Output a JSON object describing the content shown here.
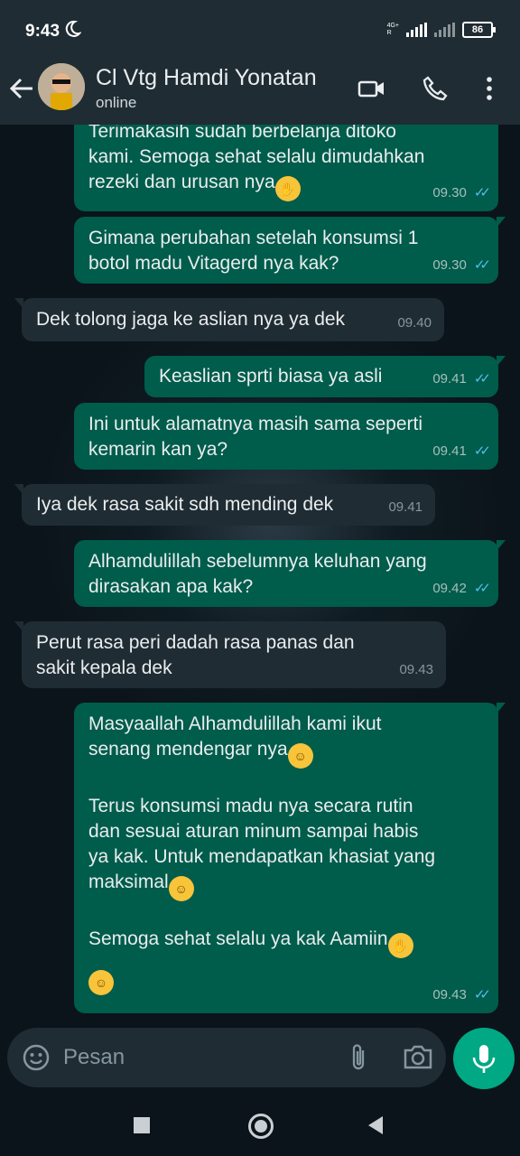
{
  "status_bar": {
    "time": "9:43",
    "network": "4G+",
    "network_sub": "R",
    "battery": "86"
  },
  "header": {
    "name": "Cl Vtg Hamdi Yonatan",
    "status": "online"
  },
  "messages": [
    {
      "dir": "out",
      "text": "Terimakasih sudah berbelanja ditoko\nkami. Semoga sehat selalu dimudahkan\nrezeki dan urusan nya",
      "emoji": "🤲",
      "time": "09.30",
      "read": true
    },
    {
      "dir": "out",
      "text": "Gimana perubahan setelah konsumsi 1\nbotol madu Vitagerd nya kak?",
      "time": "09.30",
      "read": true
    },
    {
      "dir": "in",
      "text": "Dek tolong jaga ke aslian nya ya dek",
      "time": "09.40"
    },
    {
      "dir": "out",
      "text": "Keaslian sprti biasa ya asli",
      "time": "09.41",
      "read": true
    },
    {
      "dir": "out",
      "text": "Ini untuk alamatnya masih sama seperti\nkemarin kan ya?",
      "time": "09.41",
      "read": true
    },
    {
      "dir": "in",
      "text": "Iya dek rasa sakit sdh mending dek",
      "time": "09.41"
    },
    {
      "dir": "out",
      "text": "Alhamdulillah sebelumnya keluhan yang\ndirasakan apa kak?",
      "time": "09.42",
      "read": true
    },
    {
      "dir": "in",
      "text": "Perut rasa peri dadah rasa panas dan\nsakit kepala dek",
      "time": "09.43"
    },
    {
      "dir": "out",
      "text_parts": [
        "Masyaallah Alhamdulillah kami ikut\nsenang mendengar nya",
        "Terus konsumsi madu nya secara rutin\ndan sesuai aturan minum sampai habis\nya kak. Untuk mendapatkan khasiat yang\nmaksimal",
        "Semoga sehat selalu ya kak Aamiin"
      ],
      "time": "09.43",
      "read": true
    }
  ],
  "input": {
    "placeholder": "Pesan"
  },
  "colors": {
    "outgoing": "#005c4b",
    "incoming": "#202c33",
    "accent": "#00a884",
    "read_ticks": "#53bdeb"
  },
  "icons": [
    "back-arrow-icon",
    "video-call-icon",
    "phone-icon",
    "more-menu-icon",
    "emoji-icon",
    "attach-icon",
    "camera-icon",
    "mic-icon"
  ]
}
